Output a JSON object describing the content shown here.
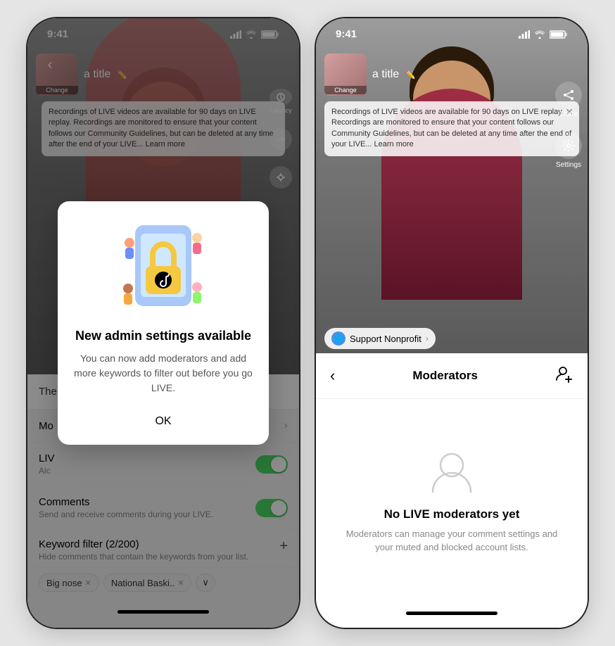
{
  "phone1": {
    "status": {
      "time": "9:41"
    },
    "live": {
      "thumbnail_label": "Change",
      "title": "a title",
      "recording_notice": "Recordings of LIVE videos are available for 90 days on LIVE replay. Recordings are monitored to ensure that your content follows our Community Guidelines, but can be deleted at any time after the end of your LIVE... Learn more"
    },
    "dialog": {
      "title": "New admin settings available",
      "body": "You can now add moderators and add more keywords to filter out before you go LIVE.",
      "ok_label": "OK"
    },
    "settings": {
      "title_row_label": "The",
      "moderators_row": "Mo",
      "live_row_label": "LIV",
      "live_row_sub": "Alc",
      "comments_label": "Comments",
      "comments_sub": "Send and receive comments during your LIVE.",
      "keyword_label": "Keyword filter (2/200)",
      "keyword_sub": "Hide comments that contain the keywords from your list.",
      "tag1": "Big nose",
      "tag2": "National Baski.."
    }
  },
  "phone2": {
    "status": {
      "time": "9:41"
    },
    "live": {
      "thumbnail_label": "Change",
      "title": "a title",
      "recording_notice": "Recordings of LIVE videos are available for 90 days on LIVE replay. Recordings are monitored to ensure that your content follows our Community Guidelines, but can be deleted at any time after the end of your LIVE... Learn more",
      "support_label": "Support Nonprofit",
      "share_label": "Share",
      "settings_label": "Settings"
    },
    "moderators": {
      "header_title": "Moderators",
      "back_label": "‹",
      "add_icon_label": "Add moderator",
      "empty_title": "No LIVE moderators yet",
      "empty_sub": "Moderators can manage your comment settings and your muted and blocked account lists."
    }
  },
  "icons": {
    "signal": "▲▲▲",
    "wifi": "wifi",
    "battery": "battery"
  }
}
